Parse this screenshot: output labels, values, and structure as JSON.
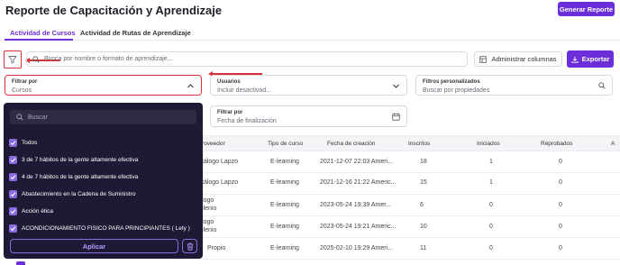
{
  "header": {
    "title": "Reporte de Capacitación y Aprendizaje",
    "report_button": "Generar Reporte"
  },
  "tabs": [
    {
      "label": "Actividad de Cursos",
      "active": true
    },
    {
      "label": "Actividad de Rutas de Aprendizaje",
      "active": false
    }
  ],
  "toolbar": {
    "search_placeholder": "Busca por nombre o formato de aprendizaje...",
    "columns_button": "Administrar columnas",
    "export_button": "Exportar"
  },
  "filters": {
    "filter_by_label": "Filtrar por",
    "filter_by_value": "Cursos",
    "users_label": "Usuarios",
    "users_value": "Incluir desactivad...",
    "custom_label": "Filtros personalizados",
    "custom_placeholder": "Buscar por propiedades",
    "filter_by2_label": "Filtrar por",
    "filter_by2_value": "Fecha de finalización"
  },
  "dropdown": {
    "search_placeholder": "Buscar",
    "items": [
      "Todos",
      "3 de 7 hábitos de la gente altamente efectiva",
      "4 de 7 hábitos de la gente altamente efectiva",
      "Abastecimiento en la Cadena de Suministro",
      "Acción ética",
      "ACONDICIONAMIENTO FISICO PARA PRINCIPIANTES ( Lety )"
    ],
    "apply_button": "Aplicar"
  },
  "table": {
    "headers": [
      "roveedor",
      "Tipo de curso",
      "Fecha de creación",
      "Inscritos",
      "Iniciados",
      "Reprobados",
      "A"
    ],
    "rows": [
      {
        "prov1": "tálogo Lapzo",
        "prov2": "",
        "tipo": "E-learning",
        "fecha": "2021-12-07 22:03 Ameri...",
        "inscritos": "18",
        "iniciados": "1",
        "reprobados": "0"
      },
      {
        "prov1": "tálogo Lapzo",
        "prov2": "",
        "tipo": "E-learning",
        "fecha": "2021-12-16 21:22 Americ...",
        "inscritos": "15",
        "iniciados": "1",
        "reprobados": "0"
      },
      {
        "prov1": "logo",
        "prov2": "ilenio",
        "tipo": "E-learning",
        "fecha": "2023-05-24 19:39 Amer...",
        "inscritos": "6",
        "iniciados": "0",
        "reprobados": "0"
      },
      {
        "prov1": "logo",
        "prov2": "ilenio",
        "tipo": "E-learning",
        "fecha": "2023-05-24 19:21 Americ...",
        "inscritos": "10",
        "iniciados": "0",
        "reprobados": "0"
      },
      {
        "prov1": "Propio",
        "prov2": "",
        "tipo": "E-learning",
        "fecha": "2025-02-10 19:29 Ameri...",
        "inscritos": "11",
        "iniciados": "0",
        "reprobados": "0"
      }
    ]
  },
  "colors": {
    "accent": "#6a2fd8",
    "highlight": "#d7323a",
    "dropdown_bg": "#1e1a35"
  }
}
